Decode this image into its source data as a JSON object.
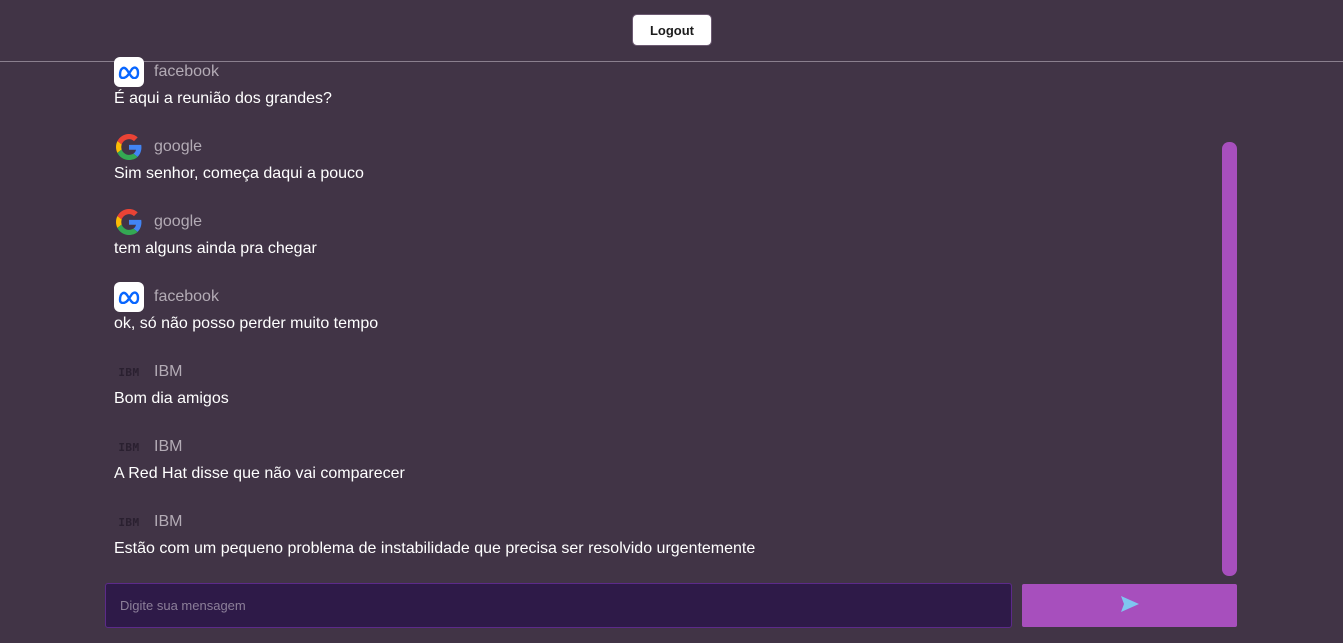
{
  "header": {
    "logout_label": "Logout"
  },
  "messages": [
    {
      "user": "facebook",
      "text": "É aqui a reunião dos grandes?",
      "icon": "meta-logo-icon"
    },
    {
      "user": "google",
      "text": "Sim senhor, começa daqui a pouco",
      "icon": "google-logo-icon"
    },
    {
      "user": "google",
      "text": "tem alguns ainda pra chegar",
      "icon": "google-logo-icon"
    },
    {
      "user": "facebook",
      "text": "ok, só não posso perder muito tempo",
      "icon": "meta-logo-icon"
    },
    {
      "user": "IBM",
      "text": "Bom dia amigos",
      "icon": "ibm-logo-icon",
      "logo_text": "IBM"
    },
    {
      "user": "IBM",
      "text": "A Red Hat disse que não vai comparecer",
      "icon": "ibm-logo-icon",
      "logo_text": "IBM"
    },
    {
      "user": "IBM",
      "text": "Estão com um pequeno problema de instabilidade que precisa ser resolvido urgentemente",
      "icon": "ibm-logo-icon",
      "logo_text": "IBM"
    }
  ],
  "composer": {
    "placeholder": "Digite sua mensagem",
    "value": "",
    "send_icon": "send-arrow-icon"
  },
  "colors": {
    "background": "#413446",
    "accent": "#a74fbd",
    "input_bg": "#2e1a48"
  }
}
